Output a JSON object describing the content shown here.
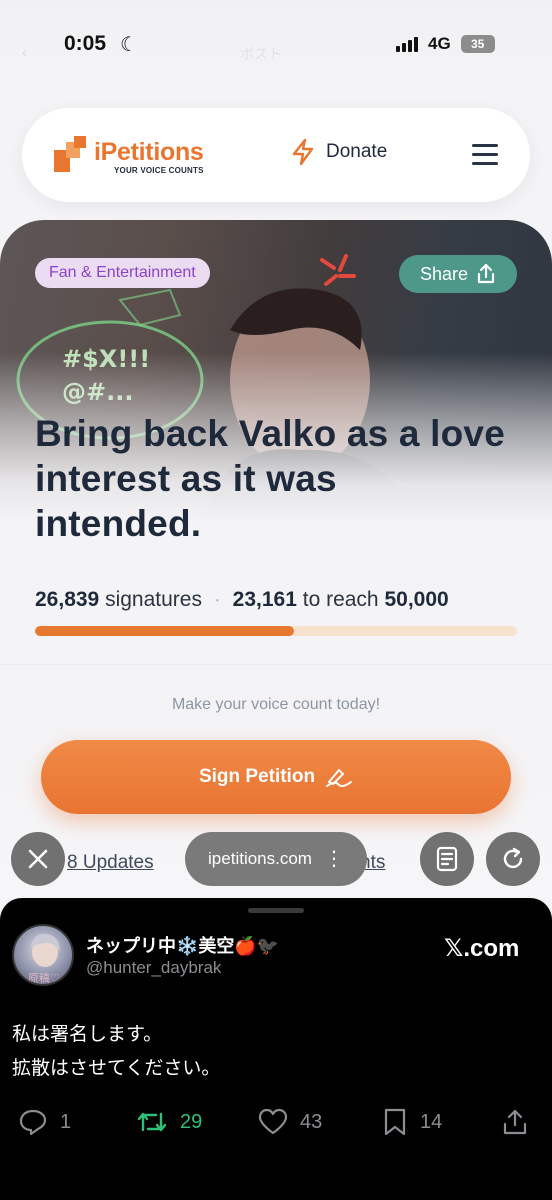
{
  "status_bar": {
    "time": "0:05",
    "network": "4G",
    "battery": "35"
  },
  "background_ghost": {
    "back_label": "‹",
    "title": "ポスト"
  },
  "navbar": {
    "brand_name": "iPetitions",
    "brand_tagline": "YOUR VOICE COUNTS",
    "donate_label": "Donate",
    "brand_color": "#e9762e"
  },
  "hero": {
    "category": "Fan & Entertainment",
    "share_label": "Share",
    "title": "Bring back Valko as a love interest as it was intended."
  },
  "stats": {
    "signatures": "26,839",
    "signatures_label": "signatures",
    "remaining": "23,161",
    "reach_label": "to reach",
    "goal": "50,000",
    "progress_fraction": 0.537
  },
  "cta": {
    "note": "Make your voice count today!",
    "sign_label": "Sign Petition",
    "accent_color": "#e97431"
  },
  "bottom_links": {
    "updates": "8 Updates",
    "other_suffix": "nts"
  },
  "browser": {
    "url": "ipetitions.com"
  },
  "tweet": {
    "display_name": "ネップリ中❄️美空🍎🐦‍⬛",
    "handle": "@hunter_daybrak",
    "avatar_caption": "原稿♡",
    "source": "𝕏.com",
    "text": "私は署名します。\n拡散はさせてください。",
    "replies": "1",
    "retweets": "29",
    "likes": "43",
    "bookmarks": "14"
  }
}
